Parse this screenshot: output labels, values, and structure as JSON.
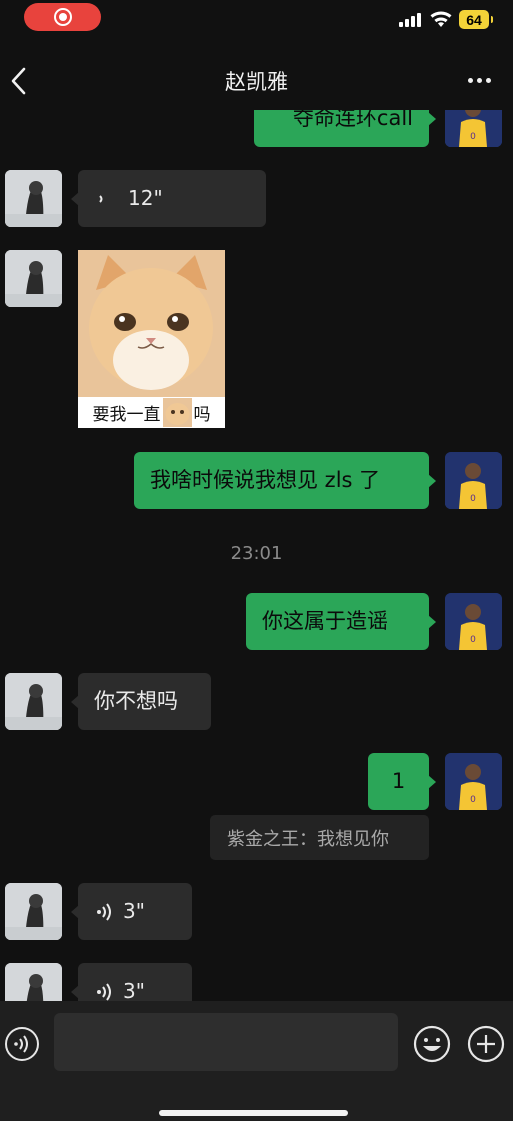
{
  "status_bar": {
    "battery": "64"
  },
  "nav": {
    "title": "赵凯雅"
  },
  "messages": {
    "m1_text": "夺命连环call",
    "m2_duration": "12\"",
    "m3_caption_before": "要我一直",
    "m3_caption_after": "吗",
    "m4_text": "我啥时候说我想见 zls 了",
    "time_divider": "23:01",
    "m5_text": "你这属于造谣",
    "m6_text": "你不想吗",
    "m7_text": "1",
    "m7_quote": "紫金之王：我想见你",
    "m8_duration": "3\"",
    "m9_duration": "3\""
  },
  "input_bar": {
    "placeholder": ""
  },
  "colors": {
    "background": "#111111",
    "incoming_bubble": "#2c2c2c",
    "outgoing_bubble": "#2ba658",
    "record_pill": "#e8433d",
    "battery": "#f3d338"
  },
  "icons": {
    "record": "record-icon",
    "back": "chevron-left-icon",
    "more": "more-icon",
    "voice": "voice-icon",
    "emoji": "emoji-icon",
    "plus": "plus-icon"
  }
}
